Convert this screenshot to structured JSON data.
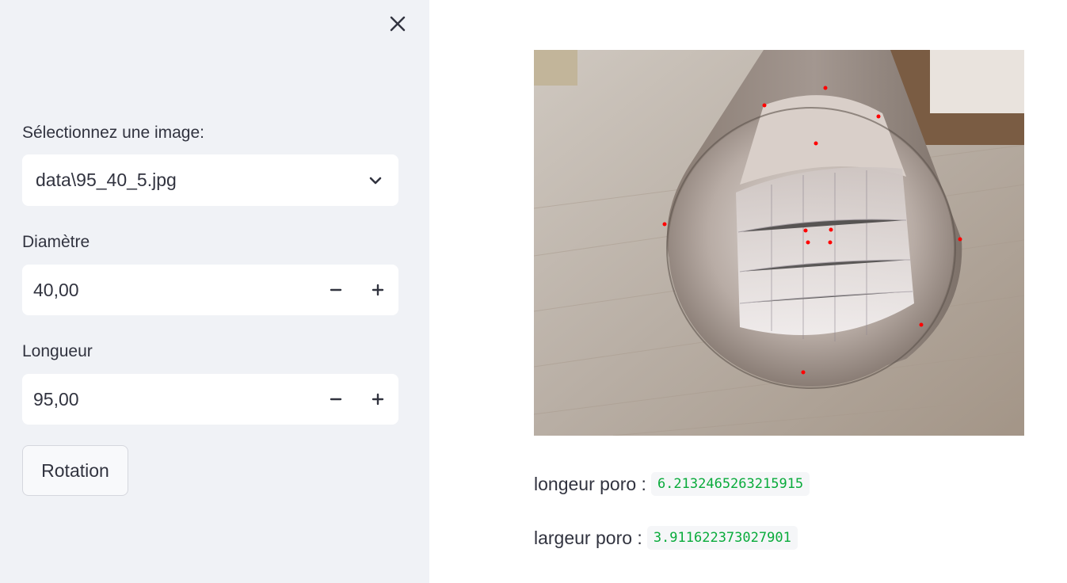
{
  "sidebar": {
    "close_icon": "close-icon",
    "image_select": {
      "label": "Sélectionnez une image:",
      "value": "data\\95_40_5.jpg"
    },
    "diametre": {
      "label": "Diamètre",
      "value": "40,00"
    },
    "longueur": {
      "label": "Longueur",
      "value": "95,00"
    },
    "rotation_button": "Rotation"
  },
  "main": {
    "image_subject": "cardboard tube on wooden floor with red detection points",
    "metrics": [
      {
        "label": "longeur poro :",
        "value": "6.2132465263215915"
      },
      {
        "label": "largeur poro :",
        "value": "3.911622373027901"
      }
    ]
  },
  "colors": {
    "sidebar_bg": "#f0f2f6",
    "code_text": "#09ab3b",
    "marker": "#ff0000"
  }
}
